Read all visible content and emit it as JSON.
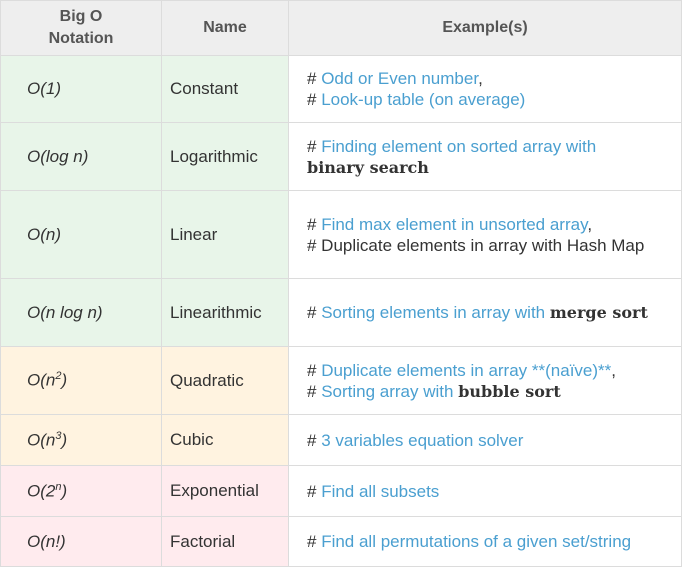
{
  "headers": {
    "notation": "Big O Notation",
    "name": "Name",
    "examples": "Example(s)"
  },
  "rows": [
    {
      "notation": "O(1)",
      "name": "Constant",
      "ex1_hash": "# ",
      "ex1_link": "Odd or Even number",
      "ex1_tail": ",",
      "ex2_hash": "# ",
      "ex2_link": "Look-up table (on average)"
    },
    {
      "notation": "O(log n)",
      "name": "Logarithmic",
      "ex1_hash": "# ",
      "ex1_link": "Finding element on sorted array with",
      "ex1_bold": "binary search"
    },
    {
      "notation": "O(n)",
      "name": "Linear",
      "ex1_hash": "# ",
      "ex1_link": "Find max element in unsorted array",
      "ex1_tail": ",",
      "ex2_text": "# Duplicate elements in array with Hash Map"
    },
    {
      "notation": "O(n log n)",
      "name": "Linearithmic",
      "ex1_hash": "# ",
      "ex1_link": "Sorting elements in array with",
      "ex1_bold": "merge sort"
    },
    {
      "notation_base": "O(n",
      "notation_sup": "2",
      "notation_close": ")",
      "name": "Quadratic",
      "ex1_hash": "# ",
      "ex1_link": "Duplicate elements in array **(naïve)**",
      "ex1_tail": ",",
      "ex2_hash": "# ",
      "ex2_link": "Sorting array with",
      "ex2_bold": "bubble sort"
    },
    {
      "notation_base": "O(n",
      "notation_sup": "3",
      "notation_close": ")",
      "name": "Cubic",
      "ex1_hash": "# ",
      "ex1_link": "3 variables equation solver"
    },
    {
      "notation_base": "O(2",
      "notation_sup": "n",
      "notation_close": ")",
      "name": "Exponential",
      "ex1_hash": "# ",
      "ex1_link": "Find all subsets"
    },
    {
      "notation": "O(n!)",
      "name": "Factorial",
      "ex1_hash": "# ",
      "ex1_link": "Find all permutations of a given set/string"
    }
  ]
}
